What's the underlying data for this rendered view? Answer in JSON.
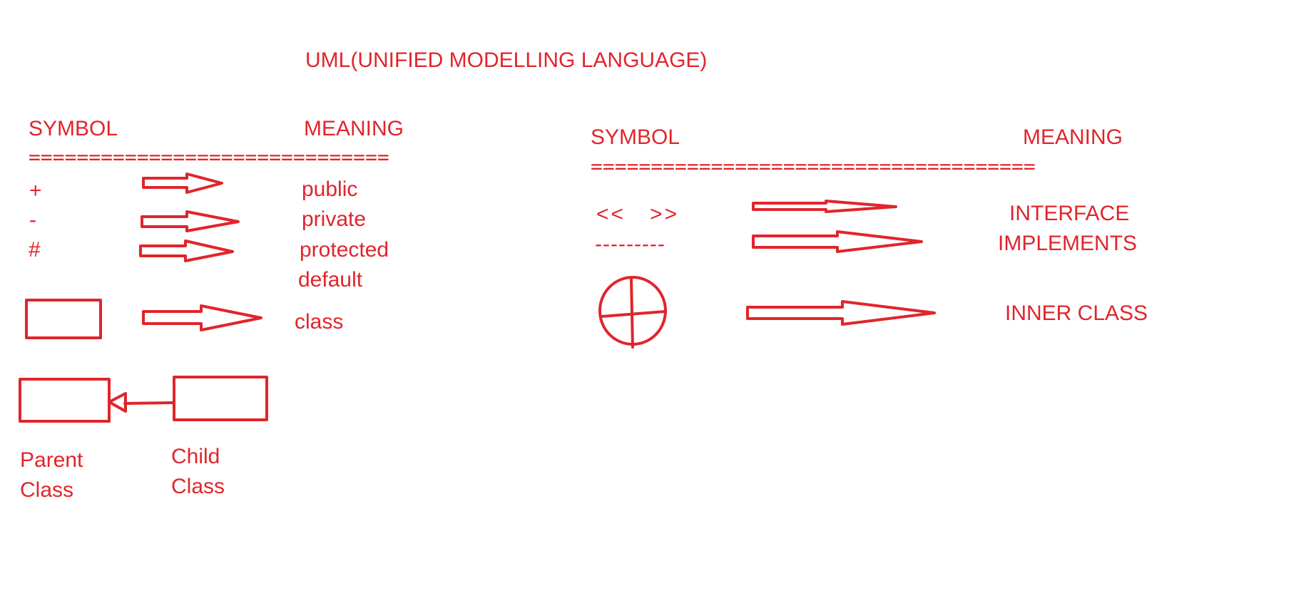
{
  "title": "UML(UNIFIED MODELLING LANGUAGE)",
  "left_table": {
    "symbol_header": "SYMBOL",
    "meaning_header": "MEANING",
    "separator": "==============================",
    "rows": [
      {
        "symbol": "+",
        "meaning": "public"
      },
      {
        "symbol": "-",
        "meaning": "private"
      },
      {
        "symbol": "#",
        "meaning": "protected"
      },
      {
        "symbol": "",
        "meaning": "default"
      },
      {
        "symbol": "class-box",
        "meaning": "class"
      }
    ],
    "inheritance": {
      "parent_label_line1": "Parent",
      "parent_label_line2": "Class",
      "child_label_line1": "Child",
      "child_label_line2": "Class"
    }
  },
  "right_table": {
    "symbol_header": "SYMBOL",
    "meaning_header": "MEANING",
    "separator": "=====================================",
    "rows": [
      {
        "symbol": "<<   >>",
        "meaning": "INTERFACE"
      },
      {
        "symbol": "---------",
        "meaning": "IMPLEMENTS"
      },
      {
        "symbol": "circle-cross",
        "meaning": "INNER CLASS"
      }
    ]
  },
  "colors": {
    "ink": "#e0252c",
    "background": "#ffffff"
  }
}
